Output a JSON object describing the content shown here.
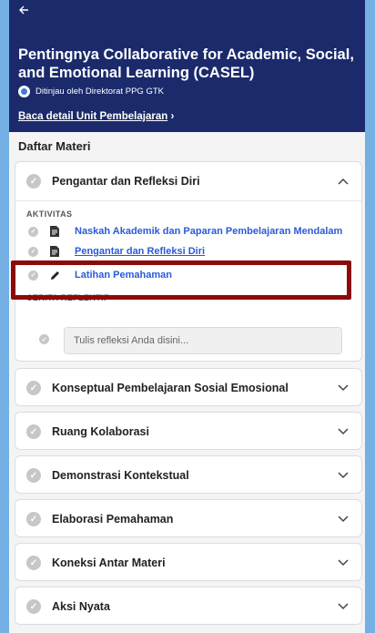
{
  "header": {
    "back_icon": "arrow-left-icon",
    "title": "Pentingnya Collaborative for Academic, Social, and Emotional Learning (CASEL)",
    "reviewer": "Ditinjau oleh Direktorat PPG GTK",
    "detail_link": "Baca detail Unit Pembelajaran",
    "detail_arrow": "›"
  },
  "section_title": "Daftar Materi",
  "expanded_module": {
    "title": "Pengantar dan Refleksi Diri",
    "activities_label": "AKTIVITAS",
    "activities": [
      {
        "label": "Naskah Akademik dan Paparan Pembelajaran Mendalam",
        "icon": "document-icon"
      },
      {
        "label": "Pengantar dan Refleksi Diri",
        "icon": "document-icon"
      },
      {
        "label": "Latihan Pemahaman",
        "icon": "pencil-icon"
      }
    ],
    "reflection_label": "CERITA REFLEKTIF",
    "reflection_placeholder": "Tulis refleksi Anda disini..."
  },
  "modules": [
    {
      "title": "Konseptual Pembelajaran Sosial Emosional"
    },
    {
      "title": "Ruang Kolaborasi"
    },
    {
      "title": "Demonstrasi Kontekstual"
    },
    {
      "title": "Elaborasi Pemahaman"
    },
    {
      "title": "Koneksi Antar Materi"
    },
    {
      "title": "Aksi Nyata"
    }
  ],
  "colors": {
    "header_bg": "#1b2a6b",
    "link": "#2a5bd7",
    "highlight": "#8b0a0a",
    "side_bg": "#74b0e4"
  }
}
